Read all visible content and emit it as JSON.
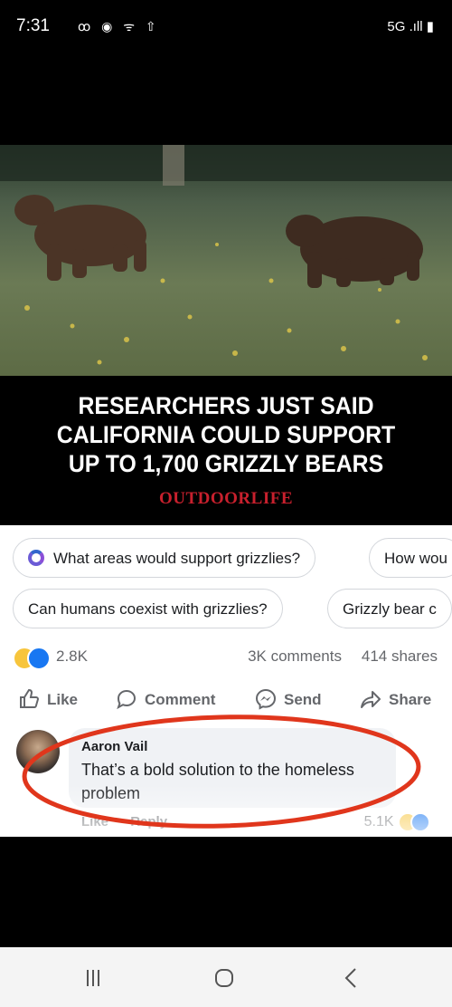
{
  "status_bar": {
    "time": "7:31",
    "icons": "ꝏ ◉ ᯤ ⇧",
    "network": "5G .ıll ▮"
  },
  "article": {
    "headline": "RESEARCHERS JUST SAID\nCALIFORNIA COULD SUPPORT\nUP TO 1,700 GRIZZLY BEARS",
    "brand": "OUTDOORLIFE"
  },
  "suggestions": {
    "row1": [
      "What areas would support grizzlies?",
      "How wou"
    ],
    "row2": [
      "Can humans coexist with grizzlies?",
      "Grizzly bear c"
    ]
  },
  "stats": {
    "reactions": "2.8K",
    "comments": "3K comments",
    "shares": "414 shares"
  },
  "actions": {
    "like": "Like",
    "comment": "Comment",
    "send": "Send",
    "share": "Share"
  },
  "comment": {
    "author": "Aaron Vail",
    "text": "That’s a bold solution to the homeless problem",
    "like": "Like",
    "reply": "Reply",
    "reactions": "5.1K"
  },
  "colors": {
    "brand_red": "#c8202d",
    "like_blue": "#1877f2",
    "annotation": "#e0361c"
  }
}
